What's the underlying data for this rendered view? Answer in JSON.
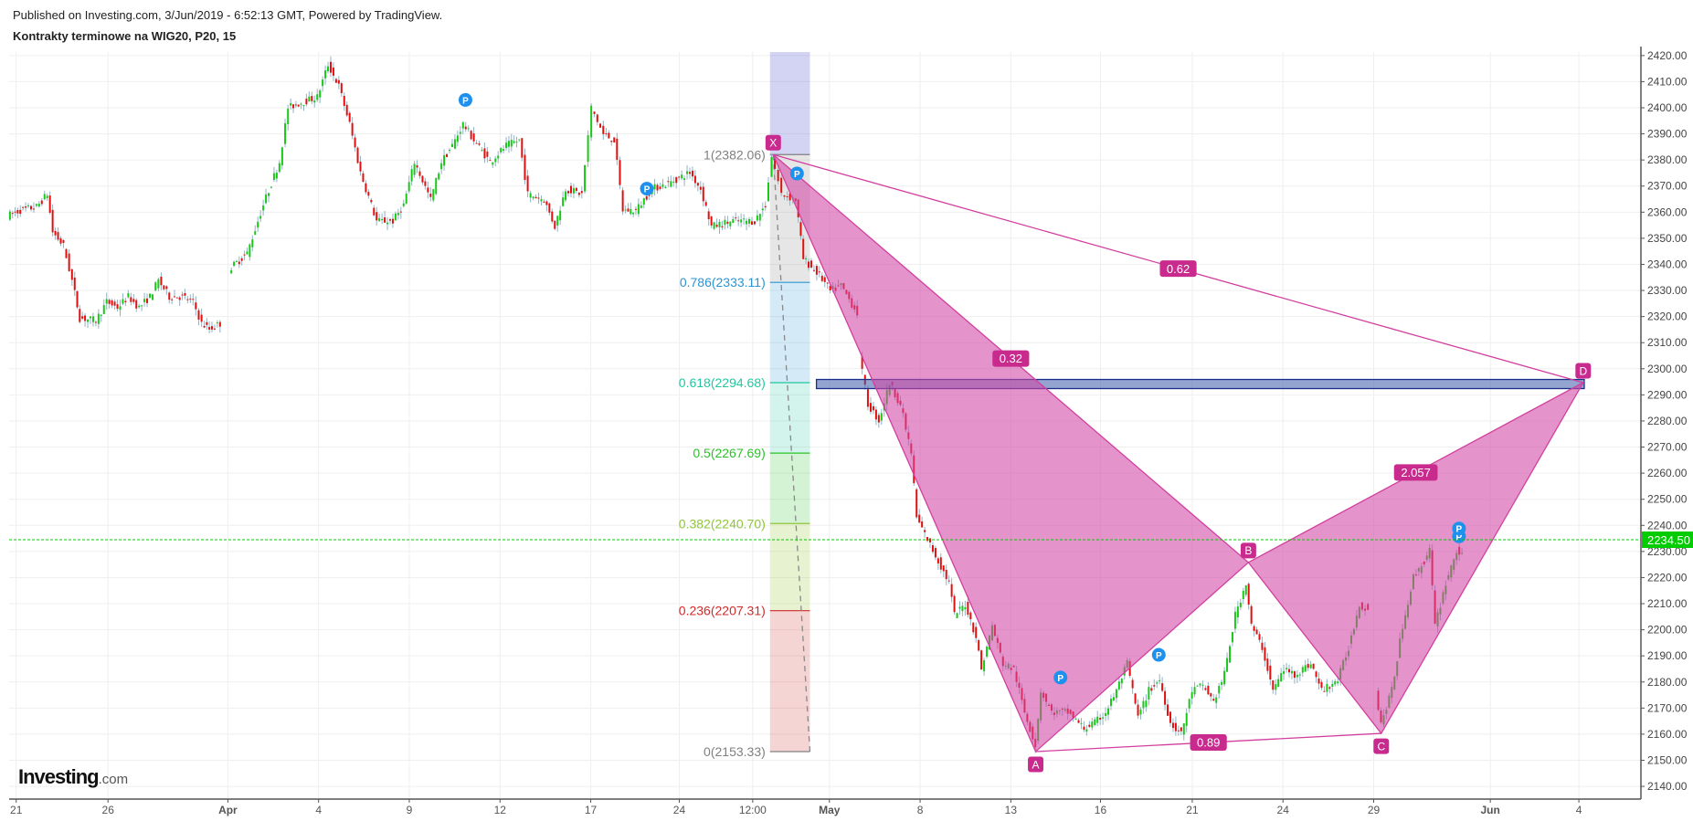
{
  "header": {
    "published": "Published on Investing.com, 3/Jun/2019 - 6:52:13 GMT, Powered by TradingView.",
    "title": "Kontrakty terminowe na WIG20, P20, 15"
  },
  "logo": {
    "main": "Investing",
    "suffix": ".com"
  },
  "colors": {
    "up": "#19c819",
    "down": "#e01010",
    "wick": "#8fb3c4",
    "pattern_fill": "rgba(210,70,165,0.58)",
    "pattern_line": "#d23f9f",
    "pattern_label": "#c82a8e",
    "pivot": "#1e90ee",
    "current_price": "#00cc00",
    "zone_fill": "rgba(60,90,170,0.55)",
    "zone_line": "#1b2f8a"
  },
  "chart_data": {
    "type": "candlestick",
    "title": "Kontrakty terminowe na WIG20, P20, 15",
    "x_unit": "15-minute bar index",
    "ylim": [
      2135,
      2425
    ],
    "xlim": [
      8,
      1510
    ],
    "y_ticks": [
      "2140.00",
      "2150.00",
      "2160.00",
      "2170.00",
      "2180.00",
      "2190.00",
      "2200.00",
      "2210.00",
      "2220.00",
      "2230.00",
      "2240.00",
      "2250.00",
      "2260.00",
      "2270.00",
      "2280.00",
      "2290.00",
      "2300.00",
      "2310.00",
      "2320.00",
      "2330.00",
      "2340.00",
      "2350.00",
      "2360.00",
      "2370.00",
      "2380.00",
      "2390.00",
      "2400.00",
      "2410.00",
      "2420.00"
    ],
    "x_ticks": [
      {
        "label": "21",
        "bar": 15,
        "bold": false
      },
      {
        "label": "26",
        "bar": 100,
        "bold": false
      },
      {
        "label": "Apr",
        "bar": 211,
        "bold": true
      },
      {
        "label": "4",
        "bar": 295,
        "bold": false
      },
      {
        "label": "9",
        "bar": 379,
        "bold": false
      },
      {
        "label": "12",
        "bar": 463,
        "bold": false
      },
      {
        "label": "17",
        "bar": 547,
        "bold": false
      },
      {
        "label": "24",
        "bar": 629,
        "bold": false
      },
      {
        "label": "12:00",
        "bar": 697,
        "bold": false
      },
      {
        "label": "May",
        "bar": 768,
        "bold": true
      },
      {
        "label": "8",
        "bar": 852,
        "bold": false
      },
      {
        "label": "13",
        "bar": 936,
        "bold": false
      },
      {
        "label": "16",
        "bar": 1019,
        "bold": false
      },
      {
        "label": "21",
        "bar": 1104,
        "bold": false
      },
      {
        "label": "24",
        "bar": 1188,
        "bold": false
      },
      {
        "label": "29",
        "bar": 1272,
        "bold": false
      },
      {
        "label": "Jun",
        "bar": 1380,
        "bold": true
      },
      {
        "label": "4",
        "bar": 1462,
        "bold": false
      }
    ],
    "price_path_segments": [
      [
        [
          8,
          2358.6
        ],
        [
          20,
          2360.7
        ],
        [
          35,
          2362
        ],
        [
          45,
          2366.9
        ],
        [
          50,
          2352.4
        ],
        [
          60,
          2347.1
        ],
        [
          68,
          2333.8
        ],
        [
          75,
          2319.4
        ],
        [
          90,
          2318.5
        ],
        [
          100,
          2325.6
        ],
        [
          110,
          2323.5
        ],
        [
          120,
          2327.6
        ],
        [
          130,
          2323.5
        ],
        [
          140,
          2327.6
        ],
        [
          148,
          2333.8
        ],
        [
          158,
          2327.6
        ],
        [
          170,
          2327.6
        ],
        [
          180,
          2325.6
        ],
        [
          188,
          2317.3
        ],
        [
          195,
          2315.2
        ],
        [
          205,
          2317.3
        ]
      ],
      [
        [
          213,
          2338
        ],
        [
          230,
          2344.2
        ],
        [
          245,
          2362.8
        ],
        [
          260,
          2379.3
        ],
        [
          268,
          2400
        ],
        [
          280,
          2402
        ],
        [
          295,
          2404.1
        ],
        [
          305,
          2416.5
        ],
        [
          315,
          2408.3
        ],
        [
          325,
          2393.8
        ],
        [
          335,
          2375.2
        ],
        [
          350,
          2356.6
        ],
        [
          365,
          2356.6
        ],
        [
          375,
          2362.8
        ],
        [
          385,
          2379.3
        ],
        [
          400,
          2364.8
        ],
        [
          410,
          2379.3
        ],
        [
          420,
          2385.5
        ],
        [
          430,
          2393.8
        ],
        [
          440,
          2387.6
        ],
        [
          455,
          2379.3
        ],
        [
          470,
          2385.5
        ],
        [
          482,
          2387.6
        ],
        [
          490,
          2366.9
        ],
        [
          505,
          2364.8
        ],
        [
          515,
          2354.5
        ],
        [
          525,
          2369
        ],
        [
          540,
          2366.9
        ],
        [
          549,
          2400
        ],
        [
          560,
          2389.7
        ],
        [
          570,
          2387.6
        ],
        [
          578,
          2360.7
        ],
        [
          590,
          2360.7
        ],
        [
          605,
          2369
        ],
        [
          620,
          2371
        ],
        [
          640,
          2375.2
        ],
        [
          650,
          2369
        ],
        [
          660,
          2354.5
        ],
        [
          680,
          2356.6
        ],
        [
          700,
          2356.6
        ],
        [
          710,
          2362.8
        ],
        [
          716,
          2381.4
        ],
        [
          725,
          2366.9
        ],
        [
          738,
          2364.8
        ],
        [
          745,
          2342.1
        ],
        [
          760,
          2335.9
        ],
        [
          770,
          2329.7
        ],
        [
          780,
          2331.8
        ],
        [
          795,
          2321.4
        ]
      ],
      [
        [
          797,
          2304.9
        ],
        [
          805,
          2286.3
        ],
        [
          815,
          2280.1
        ],
        [
          825,
          2294.5
        ],
        [
          835,
          2286.3
        ],
        [
          845,
          2267.7
        ],
        [
          850,
          2242.8
        ],
        [
          860,
          2234.6
        ],
        [
          870,
          2226.3
        ],
        [
          880,
          2218
        ],
        [
          885,
          2205.6
        ],
        [
          895,
          2209.8
        ],
        [
          905,
          2197.4
        ],
        [
          910,
          2184.9
        ],
        [
          920,
          2201.5
        ],
        [
          930,
          2187
        ],
        [
          940,
          2184.9
        ],
        [
          950,
          2168.4
        ],
        [
          960,
          2156
        ],
        [
          965,
          2176.7
        ],
        [
          975,
          2168.4
        ],
        [
          990,
          2168.4
        ],
        [
          1005,
          2162.2
        ],
        [
          1015,
          2164.3
        ],
        [
          1025,
          2168.4
        ],
        [
          1035,
          2176.7
        ],
        [
          1045,
          2187
        ],
        [
          1055,
          2166.3
        ],
        [
          1065,
          2176.7
        ],
        [
          1075,
          2180.8
        ],
        [
          1085,
          2164.3
        ],
        [
          1095,
          2160.1
        ],
        [
          1105,
          2176.7
        ],
        [
          1115,
          2178.7
        ],
        [
          1125,
          2172.5
        ],
        [
          1135,
          2182.9
        ],
        [
          1145,
          2205.6
        ],
        [
          1155,
          2218
        ],
        [
          1160,
          2201.5
        ],
        [
          1170,
          2193.2
        ],
        [
          1180,
          2176.7
        ],
        [
          1190,
          2184.9
        ],
        [
          1200,
          2182.9
        ],
        [
          1215,
          2187
        ],
        [
          1225,
          2176.7
        ],
        [
          1240,
          2180.8
        ],
        [
          1250,
          2193.2
        ],
        [
          1260,
          2209.8
        ],
        [
          1268,
          2207.7
        ]
      ],
      [
        [
          1275,
          2176.7
        ],
        [
          1280,
          2164.3
        ],
        [
          1290,
          2176.7
        ],
        [
          1300,
          2201.5
        ],
        [
          1310,
          2220.1
        ],
        [
          1320,
          2226.3
        ],
        [
          1325,
          2230.4
        ],
        [
          1330,
          2201.5
        ],
        [
          1340,
          2218
        ],
        [
          1350,
          2230.4
        ],
        [
          1355,
          2228
        ]
      ]
    ],
    "current_price": {
      "value": 2234.5,
      "label": "2234.50"
    },
    "fib_retracement": {
      "bar_start": 713,
      "bar_end": 750,
      "trend": [
        [
          716,
          2382.06
        ],
        [
          750,
          2153.33
        ]
      ],
      "levels": [
        {
          "ratio": 1,
          "price": 2382.06,
          "label": "1(2382.06)",
          "color": "#808080",
          "fill": "rgba(128,128,128,0.2)"
        },
        {
          "ratio": 0.786,
          "price": 2333.11,
          "label": "0.786(2333.11)",
          "color": "#2a95d2",
          "fill": "rgba(42,149,210,0.2)"
        },
        {
          "ratio": 0.618,
          "price": 2294.68,
          "label": "0.618(2294.68)",
          "color": "#22c7a0",
          "fill": "rgba(34,199,160,0.2)"
        },
        {
          "ratio": 0.5,
          "price": 2267.69,
          "label": "0.5(2267.69)",
          "color": "#2ac32a",
          "fill": "rgba(42,195,42,0.2)"
        },
        {
          "ratio": 0.382,
          "price": 2240.7,
          "label": "0.382(2240.70)",
          "color": "#8fc53a",
          "fill": "rgba(160,205,70,0.25)"
        },
        {
          "ratio": 0.236,
          "price": 2207.31,
          "label": "0.236(2207.31)",
          "color": "#d22a2a",
          "fill": "rgba(210,60,60,0.22)"
        },
        {
          "ratio": 0,
          "price": 2153.33,
          "label": "0(2153.33)",
          "color": "#808080",
          "fill": null
        }
      ],
      "above_fill": "rgba(110,110,220,0.3)"
    },
    "harmonic_pattern": {
      "points": [
        {
          "label": "X",
          "bar": 716,
          "price": 2382.06,
          "pos": "above"
        },
        {
          "label": "A",
          "bar": 959,
          "price": 2153.33,
          "pos": "below"
        },
        {
          "label": "B",
          "bar": 1156,
          "price": 2225.8,
          "pos": "above"
        },
        {
          "label": "C",
          "bar": 1279,
          "price": 2160.3,
          "pos": "below"
        },
        {
          "label": "D",
          "bar": 1466,
          "price": 2294.7,
          "pos": "above"
        }
      ],
      "ratios": [
        {
          "label": "0.32",
          "from": "X",
          "to": "B"
        },
        {
          "label": "0.62",
          "from": "X",
          "to": "D"
        },
        {
          "label": "2.057",
          "from": "B",
          "to": "D"
        },
        {
          "label": "0.89",
          "from": "A",
          "to": "C"
        }
      ]
    },
    "target_zone": {
      "bar_start": 756,
      "bar_end": 1467,
      "price_low": 2292.4,
      "price_high": 2295.9
    },
    "pivot_markers": [
      {
        "label": "P",
        "bar": 431,
        "price": 2398.8
      },
      {
        "label": "P",
        "bar": 599,
        "price": 2364.8
      },
      {
        "label": "P",
        "bar": 738,
        "price": 2370.6
      },
      {
        "label": "P",
        "bar": 982,
        "price": 2177.5
      },
      {
        "label": "P",
        "bar": 1073,
        "price": 2186.2
      },
      {
        "label": "P",
        "bar": 1351,
        "price": 2231.6
      },
      {
        "label": "P",
        "bar": 1351,
        "price": 2234.6
      }
    ]
  }
}
